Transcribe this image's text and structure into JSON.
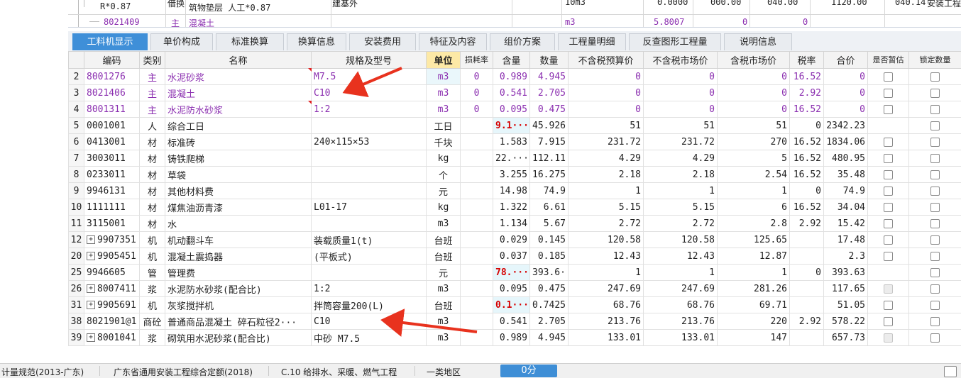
{
  "top_rows": {
    "r1_code": "R*0.87",
    "r1_type": "借换",
    "r1_name": "筑物垫层 人工*0.87",
    "r1_spec": "建基外",
    "r1_unit": "10m3",
    "r1_v1": "0.0000",
    "r1_v2": "000.00",
    "r1_v3": "040.00",
    "r1_v4": "1120.00",
    "r1_v5": "040.14",
    "r1_v6": "安装工程",
    "r2_code": "8021409",
    "r2_type": "主",
    "r2_name": "混凝土",
    "r2_unit": "m3",
    "r2_qty": "5.8007",
    "r2_v1": "0",
    "r2_v2": "0"
  },
  "tabs": [
    "工料机显示",
    "单价构成",
    "标准换算",
    "换算信息",
    "安装费用",
    "特征及内容",
    "组价方案",
    "工程量明细",
    "反查图形工程量",
    "说明信息"
  ],
  "columns": {
    "code": "编码",
    "type": "类别",
    "name": "名称",
    "spec": "规格及型号",
    "unit": "单位",
    "loss": "损耗率",
    "content": "含量",
    "qty": "数量",
    "budget": "不含税预算价",
    "market_ex": "不含税市场价",
    "market_in": "含税市场价",
    "tax": "税率",
    "total": "合价",
    "is_temp": "是否暂估",
    "locked": "锁定数量"
  },
  "rows": [
    {
      "idx": "2",
      "code": "8001276",
      "type": "主",
      "name": "水泥砂浆",
      "spec": "M7.5",
      "unit": "m3",
      "loss": "0",
      "content": "0.989",
      "qty": "4.945",
      "budget": "0",
      "market_ex": "0",
      "market_in": "0",
      "tax": "16.52",
      "total": "0",
      "purple": true,
      "check": true
    },
    {
      "idx": "3",
      "code": "8021406",
      "type": "主",
      "name": "混凝土",
      "spec": "C10",
      "unit": "m3",
      "loss": "0",
      "content": "0.541",
      "qty": "2.705",
      "budget": "0",
      "market_ex": "0",
      "market_in": "0",
      "tax": "2.92",
      "total": "0",
      "purple": true,
      "check": true
    },
    {
      "idx": "4",
      "code": "8001311",
      "type": "主",
      "name": "水泥防水砂浆",
      "spec": "1:2",
      "unit": "m3",
      "loss": "0",
      "content": "0.095",
      "qty": "0.475",
      "budget": "0",
      "market_ex": "0",
      "market_in": "0",
      "tax": "16.52",
      "total": "0",
      "purple": true,
      "check": true
    },
    {
      "idx": "5",
      "code": "0001001",
      "type": "人",
      "name": "综合工日",
      "spec": "",
      "unit": "工日",
      "loss": "",
      "content": "9.1···",
      "qty": "45.926",
      "budget": "51",
      "market_ex": "51",
      "market_in": "51",
      "tax": "0",
      "total": "2342.23",
      "red": true,
      "check": false
    },
    {
      "idx": "6",
      "code": "0413001",
      "type": "材",
      "name": "标准砖",
      "spec": "240×115×53",
      "unit": "千块",
      "loss": "",
      "content": "1.583",
      "qty": "7.915",
      "budget": "231.72",
      "market_ex": "231.72",
      "market_in": "270",
      "tax": "16.52",
      "total": "1834.06",
      "check": true
    },
    {
      "idx": "7",
      "code": "3003011",
      "type": "材",
      "name": "铸铁爬梯",
      "spec": "",
      "unit": "kg",
      "loss": "",
      "content": "22.···",
      "qty": "112.11",
      "budget": "4.29",
      "market_ex": "4.29",
      "market_in": "5",
      "tax": "16.52",
      "total": "480.95",
      "check": true
    },
    {
      "idx": "8",
      "code": "0233011",
      "type": "材",
      "name": "草袋",
      "spec": "",
      "unit": "个",
      "loss": "",
      "content": "3.255",
      "qty": "16.275",
      "budget": "2.18",
      "market_ex": "2.18",
      "market_in": "2.54",
      "tax": "16.52",
      "total": "35.48",
      "check": true
    },
    {
      "idx": "9",
      "code": "9946131",
      "type": "材",
      "name": "其他材料费",
      "spec": "",
      "unit": "元",
      "loss": "",
      "content": "14.98",
      "qty": "74.9",
      "budget": "1",
      "market_ex": "1",
      "market_in": "1",
      "tax": "0",
      "total": "74.9",
      "check": true
    },
    {
      "idx": "10",
      "code": "1111111",
      "type": "材",
      "name": "煤焦油沥青漆",
      "spec": "L01-17",
      "unit": "kg",
      "loss": "",
      "content": "1.322",
      "qty": "6.61",
      "budget": "5.15",
      "market_ex": "5.15",
      "market_in": "6",
      "tax": "16.52",
      "total": "34.04",
      "check": true
    },
    {
      "idx": "11",
      "code": "3115001",
      "type": "材",
      "name": "水",
      "spec": "",
      "unit": "m3",
      "loss": "",
      "content": "1.134",
      "qty": "5.67",
      "budget": "2.72",
      "market_ex": "2.72",
      "market_in": "2.8",
      "tax": "2.92",
      "total": "15.42",
      "check": true
    },
    {
      "idx": "12",
      "code": "9907351",
      "type": "机",
      "name": "机动翻斗车",
      "spec": "装载质量1(t)",
      "unit": "台班",
      "loss": "",
      "content": "0.029",
      "qty": "0.145",
      "budget": "120.58",
      "market_ex": "120.58",
      "market_in": "125.65",
      "tax": "",
      "total": "17.48",
      "plus": true,
      "check": true
    },
    {
      "idx": "20",
      "code": "9905451",
      "type": "机",
      "name": "混凝土震捣器",
      "spec": "(平板式)",
      "unit": "台班",
      "loss": "",
      "content": "0.037",
      "qty": "0.185",
      "budget": "12.43",
      "market_ex": "12.43",
      "market_in": "12.87",
      "tax": "",
      "total": "2.3",
      "plus": true,
      "check": true
    },
    {
      "idx": "25",
      "code": "9946605",
      "type": "管",
      "name": "管理费",
      "spec": "",
      "unit": "元",
      "loss": "",
      "content": "78.···",
      "qty": "393.6···",
      "budget": "1",
      "market_ex": "1",
      "market_in": "1",
      "tax": "0",
      "total": "393.63",
      "red": true,
      "check": false
    },
    {
      "idx": "26",
      "code": "8007411",
      "type": "浆",
      "name": "水泥防水砂浆(配合比)",
      "spec": "1:2",
      "unit": "m3",
      "loss": "",
      "content": "0.095",
      "qty": "0.475",
      "budget": "247.69",
      "market_ex": "247.69",
      "market_in": "281.26",
      "tax": "",
      "total": "117.65",
      "plus": true,
      "check": true,
      "disabled": true
    },
    {
      "idx": "31",
      "code": "9905691",
      "type": "机",
      "name": "灰浆搅拌机",
      "spec": "拌筒容量200(L)",
      "unit": "台班",
      "loss": "",
      "content": "0.1···",
      "qty": "0.7425",
      "budget": "68.76",
      "market_ex": "68.76",
      "market_in": "69.71",
      "tax": "",
      "total": "51.05",
      "plus": true,
      "red": true,
      "check": true
    },
    {
      "idx": "38",
      "code": "8021901@1",
      "type": "商砼",
      "name": "普通商品混凝土 碎石粒径2···",
      "spec": "C10",
      "unit": "m3",
      "loss": "",
      "content": "0.541",
      "qty": "2.705",
      "budget": "213.76",
      "market_ex": "213.76",
      "market_in": "220",
      "tax": "2.92",
      "total": "578.22",
      "check": true
    },
    {
      "idx": "39",
      "code": "8001041",
      "type": "浆",
      "name": "砌筑用水泥砂浆(配合比)",
      "spec": "中砂 M7.5",
      "unit": "m3",
      "loss": "",
      "content": "0.989",
      "qty": "4.945",
      "budget": "133.01",
      "market_ex": "133.01",
      "market_in": "147",
      "tax": "",
      "total": "657.73",
      "plus": true,
      "check": true,
      "disabled": true
    }
  ],
  "status": {
    "s1": "计量规范(2013-广东)",
    "s2": "广东省通用安装工程综合定额(2018)",
    "s3": "C.10 给排水、采暖、燃气工程",
    "s4": "一类地区",
    "score": "0分"
  },
  "colors": {
    "accent": "#3f8fd8",
    "purple_text": "#8b2fb0",
    "red_text": "#d60000",
    "arrow": "#e8321e"
  }
}
